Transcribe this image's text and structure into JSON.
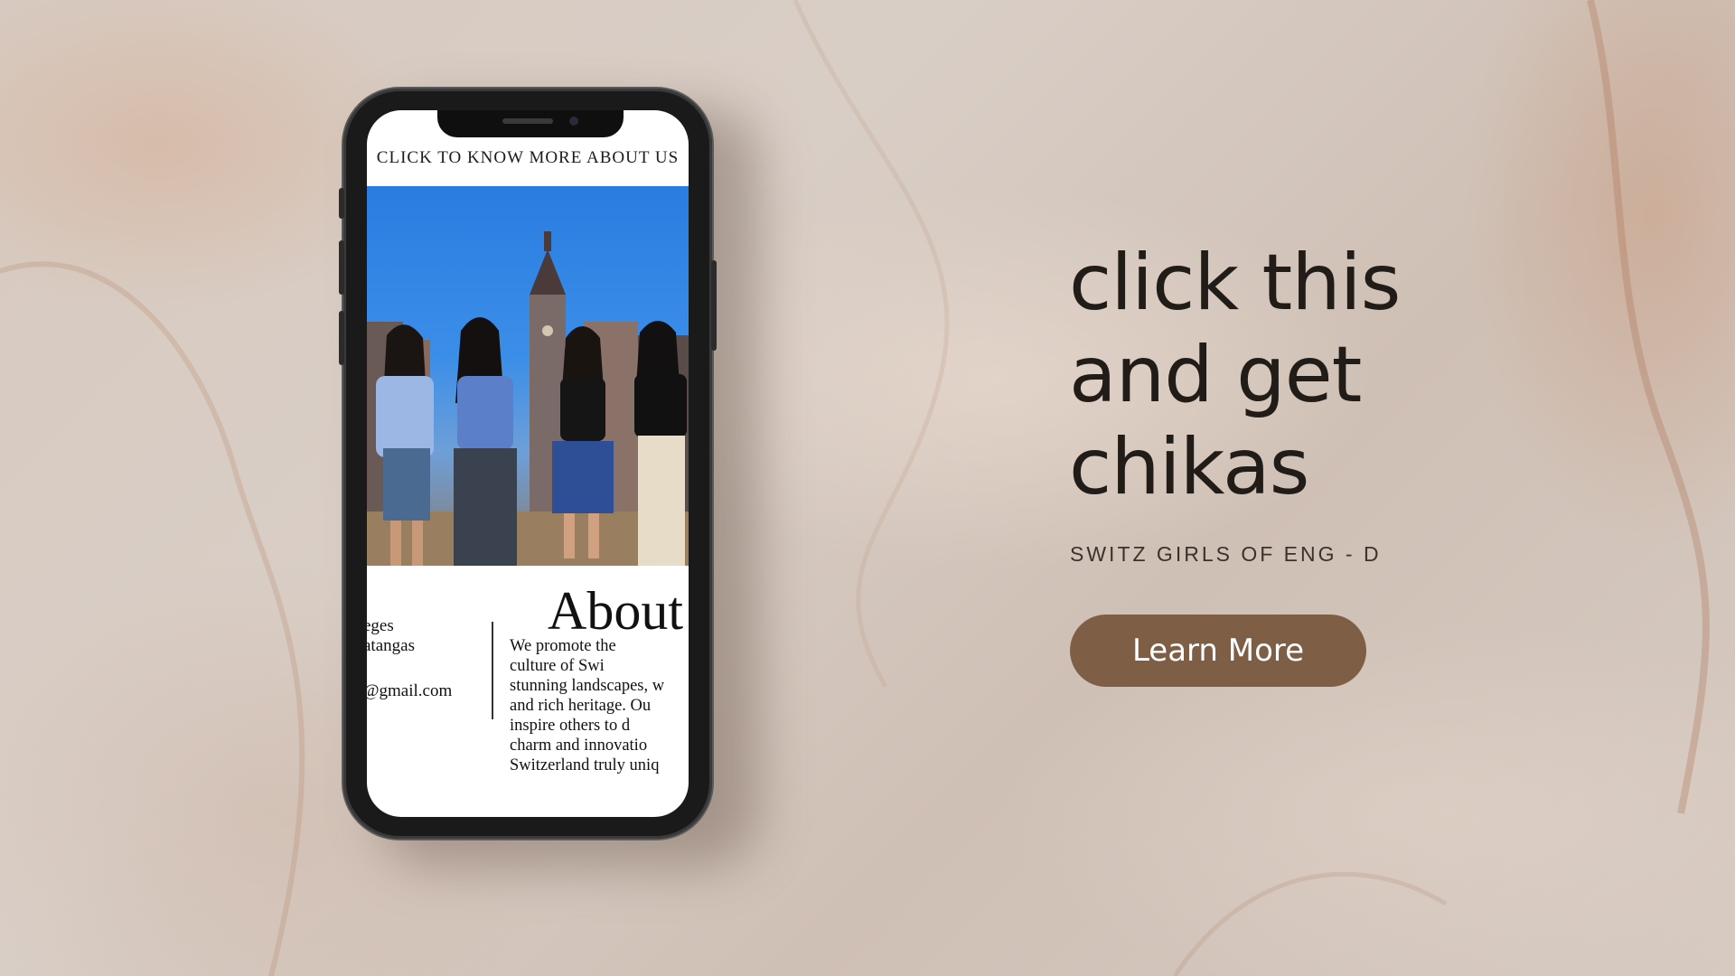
{
  "phone": {
    "header": "CLICK TO KNOW MORE ABOUT US",
    "about_title": "About",
    "contact_lines": [
      "eges",
      "atangas",
      "@gmail.com"
    ],
    "about_body": "We promote the\nculture of Swi\nstunning landscapes, w\nand rich heritage. Ou\ninspire others to d\ncharm and innovatio\nSwitzerland truly uniq"
  },
  "hero": {
    "headline_lines": [
      "click this",
      "and get",
      "chikas"
    ],
    "subtitle": "SWITZ GIRLS OF ENG - D",
    "cta_label": "Learn More"
  },
  "colors": {
    "background": "#d7c9bf",
    "headline": "#221c18",
    "cta": "#7e5f46",
    "sky": "#2a7de0"
  }
}
